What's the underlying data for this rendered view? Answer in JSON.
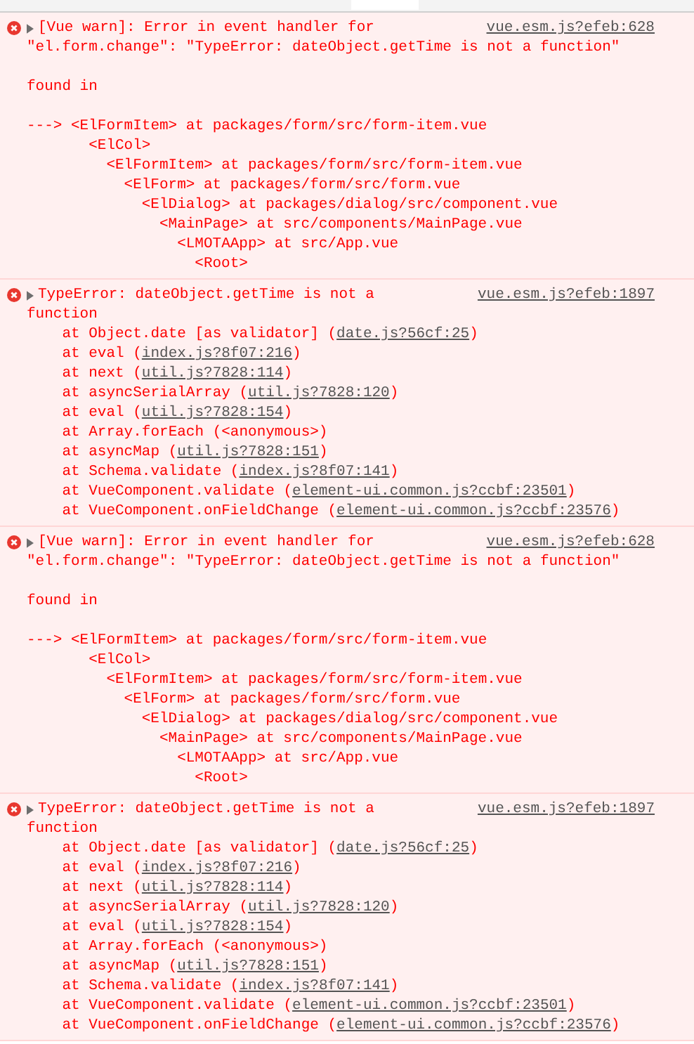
{
  "messages": [
    {
      "kind": "warn",
      "lines": [
        "[Vue warn]: Error in event handler for",
        "\"el.form.change\": \"TypeError: dateObject.getTime is not a function\""
      ],
      "source": "vue.esm.js?efeb:628",
      "found_in": "found in",
      "tree": {
        "arrow": "--->",
        "component": "<ElFormItem> at packages/form/src/form-item.vue",
        "children": [
          {
            "component": "<ElCol>",
            "children": [
              {
                "component": "<ElFormItem> at packages/form/src/form-item.vue",
                "children": [
                  {
                    "component": "<ElForm> at packages/form/src/form.vue",
                    "children": [
                      {
                        "component": "<ElDialog> at packages/dialog/src/component.vue",
                        "children": [
                          {
                            "component": "<MainPage> at src/components/MainPage.vue",
                            "children": [
                              {
                                "component": "<LMOTAApp> at src/App.vue",
                                "children": [
                                  {
                                    "component": "<Root>"
                                  }
                                ]
                              }
                            ]
                          }
                        ]
                      }
                    ]
                  }
                ]
              }
            ]
          }
        ]
      }
    },
    {
      "kind": "error",
      "lines": [
        "TypeError: dateObject.getTime is not a",
        "function"
      ],
      "source": "vue.esm.js?efeb:1897",
      "stack": [
        {
          "call": "at Object.date [as validator] (",
          "link": "date.js?56cf:25",
          "close": ")"
        },
        {
          "call": "at eval (",
          "link": "index.js?8f07:216",
          "close": ")"
        },
        {
          "call": "at next (",
          "link": "util.js?7828:114",
          "close": ")"
        },
        {
          "call": "at asyncSerialArray (",
          "link": "util.js?7828:120",
          "close": ")"
        },
        {
          "call": "at eval (",
          "link": "util.js?7828:154",
          "close": ")"
        },
        {
          "call": "at Array.forEach (<anonymous>)"
        },
        {
          "call": "at asyncMap (",
          "link": "util.js?7828:151",
          "close": ")"
        },
        {
          "call": "at Schema.validate (",
          "link": "index.js?8f07:141",
          "close": ")"
        },
        {
          "call": "at VueComponent.validate (",
          "link": "element-ui.common.js?ccbf:23501",
          "close": ")"
        },
        {
          "call": "at VueComponent.onFieldChange (",
          "link": "element-ui.common.js?ccbf:23576",
          "close": ")"
        }
      ]
    },
    {
      "kind": "warn",
      "lines": [
        "[Vue warn]: Error in event handler for",
        "\"el.form.change\": \"TypeError: dateObject.getTime is not a function\""
      ],
      "source": "vue.esm.js?efeb:628",
      "found_in": "found in",
      "tree": {
        "arrow": "--->",
        "component": "<ElFormItem> at packages/form/src/form-item.vue",
        "children": [
          {
            "component": "<ElCol>",
            "children": [
              {
                "component": "<ElFormItem> at packages/form/src/form-item.vue",
                "children": [
                  {
                    "component": "<ElForm> at packages/form/src/form.vue",
                    "children": [
                      {
                        "component": "<ElDialog> at packages/dialog/src/component.vue",
                        "children": [
                          {
                            "component": "<MainPage> at src/components/MainPage.vue",
                            "children": [
                              {
                                "component": "<LMOTAApp> at src/App.vue",
                                "children": [
                                  {
                                    "component": "<Root>"
                                  }
                                ]
                              }
                            ]
                          }
                        ]
                      }
                    ]
                  }
                ]
              }
            ]
          }
        ]
      }
    },
    {
      "kind": "error",
      "lines": [
        "TypeError: dateObject.getTime is not a",
        "function"
      ],
      "source": "vue.esm.js?efeb:1897",
      "stack": [
        {
          "call": "at Object.date [as validator] (",
          "link": "date.js?56cf:25",
          "close": ")"
        },
        {
          "call": "at eval (",
          "link": "index.js?8f07:216",
          "close": ")"
        },
        {
          "call": "at next (",
          "link": "util.js?7828:114",
          "close": ")"
        },
        {
          "call": "at asyncSerialArray (",
          "link": "util.js?7828:120",
          "close": ")"
        },
        {
          "call": "at eval (",
          "link": "util.js?7828:154",
          "close": ")"
        },
        {
          "call": "at Array.forEach (<anonymous>)"
        },
        {
          "call": "at asyncMap (",
          "link": "util.js?7828:151",
          "close": ")"
        },
        {
          "call": "at Schema.validate (",
          "link": "index.js?8f07:141",
          "close": ")"
        },
        {
          "call": "at VueComponent.validate (",
          "link": "element-ui.common.js?ccbf:23501",
          "close": ")"
        },
        {
          "call": "at VueComponent.onFieldChange (",
          "link": "element-ui.common.js?ccbf:23576",
          "close": ")"
        }
      ]
    }
  ]
}
